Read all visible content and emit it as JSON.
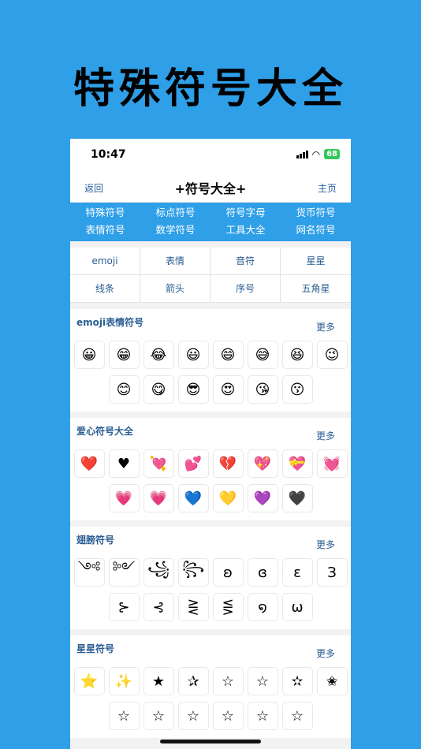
{
  "hero_title": "特殊符号大全",
  "status": {
    "time": "10:47",
    "battery": "68"
  },
  "nav": {
    "back": "返回",
    "title": "+符号大全+",
    "home": "主页"
  },
  "categories": [
    "特殊符号",
    "标点符号",
    "符号字母",
    "货币符号",
    "表情符号",
    "数学符号",
    "工具大全",
    "网名符号"
  ],
  "tags": [
    "emoji",
    "表情",
    "音符",
    "星星",
    "线条",
    "箭头",
    "序号",
    "五角星"
  ],
  "sections": [
    {
      "title": "emoji表情符号",
      "more": "更多",
      "items": [
        "😀",
        "😁",
        "😂",
        "😃",
        "😄",
        "😅",
        "😆",
        "😉",
        "😊",
        "😋",
        "😎",
        "😍",
        "😘",
        "😗"
      ]
    },
    {
      "title": "爱心符号大全",
      "more": "更多",
      "items": [
        "❤️",
        "♥",
        "💘",
        "💕",
        "💔",
        "💖",
        "💝",
        "💓",
        "💗",
        "💗",
        "💙",
        "💛",
        "💜",
        "🖤"
      ]
    },
    {
      "title": "翅膀符号",
      "more": "更多",
      "items": [
        "༺",
        "༻",
        "꧁",
        "꧂",
        "ʚ",
        "ɞ",
        "ε",
        "З",
        "⊱",
        "⊰",
        "⋛",
        "⋚",
        "໑",
        "ω"
      ]
    },
    {
      "title": "星星符号",
      "more": "更多",
      "items": [
        "⭐",
        "✨",
        "★",
        "✰",
        "☆",
        "☆",
        "✫",
        "✬",
        "☆",
        "☆",
        "☆",
        "☆",
        "☆",
        "☆"
      ]
    }
  ],
  "colors": {
    "background": "#2f9fe8",
    "link": "#2a5d92",
    "battery": "#34c759"
  }
}
